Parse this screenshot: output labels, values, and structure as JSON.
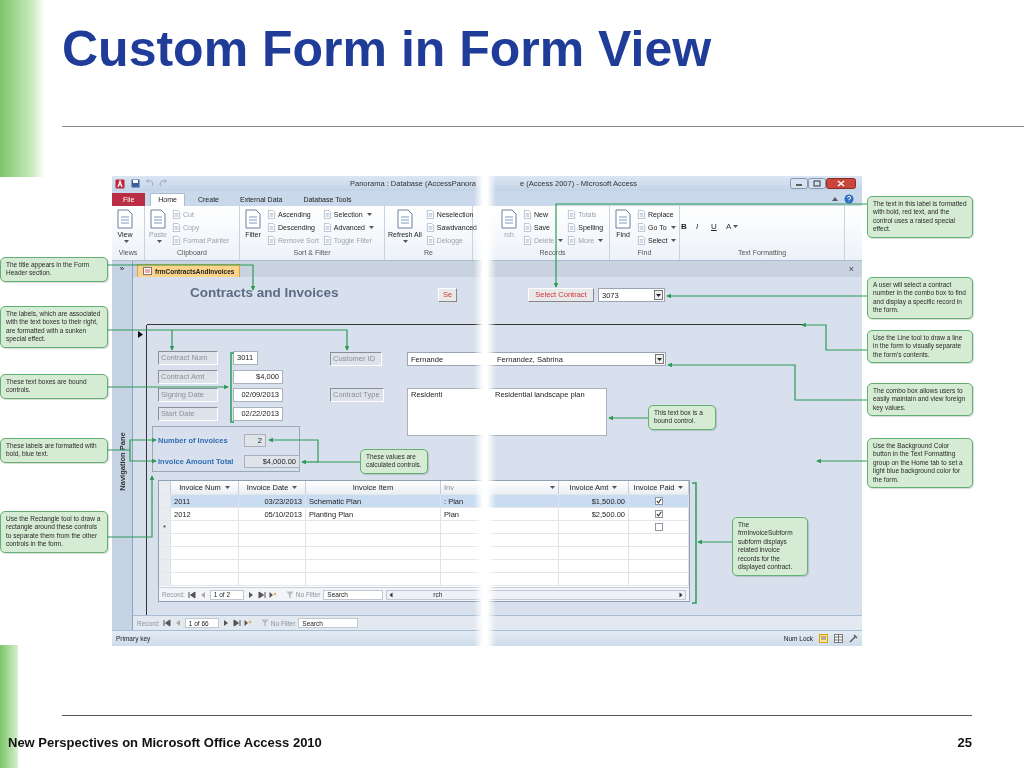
{
  "slide": {
    "title": "Custom Form in Form View",
    "footer": "New Perspectives on Microsoft Office Access 2010",
    "page_number": "25"
  },
  "window": {
    "title_parts": [
      "Panorama : Database (AccessPanora",
      "e (Access 2007) - Microsoft Access"
    ],
    "tabs": [
      {
        "label": "File",
        "kind": "file",
        "selected": false
      },
      {
        "label": "Home",
        "kind": "tab",
        "selected": true
      },
      {
        "label": "Create",
        "kind": "tab",
        "selected": false
      },
      {
        "label": "External Data",
        "kind": "tab",
        "selected": false
      },
      {
        "label": "Database Tools",
        "kind": "tab",
        "selected": false
      }
    ]
  },
  "ribbon": {
    "groups": [
      {
        "label": "Views",
        "commands": [
          {
            "label": "View",
            "kind": "large",
            "disabled": false,
            "dropdown": true
          }
        ]
      },
      {
        "label": "Clipboard",
        "commands": [
          {
            "label": "Paste",
            "kind": "large",
            "disabled": true,
            "dropdown": true
          },
          {
            "label": "Cut",
            "kind": "small",
            "disabled": true,
            "dropdown": false
          },
          {
            "label": "Copy",
            "kind": "small",
            "disabled": true,
            "dropdown": false
          },
          {
            "label": "Format Painter",
            "kind": "small",
            "disabled": true,
            "dropdown": false
          }
        ]
      },
      {
        "label": "Sort & Filter",
        "commands": [
          {
            "label": "Filter",
            "kind": "large",
            "disabled": false,
            "dropdown": false
          },
          {
            "label": "Ascending",
            "kind": "small",
            "disabled": false,
            "dropdown": false
          },
          {
            "label": "Descending",
            "kind": "small",
            "disabled": false,
            "dropdown": false
          },
          {
            "label": "Remove Sort",
            "kind": "small",
            "disabled": true,
            "dropdown": false
          },
          {
            "label": "Selection",
            "kind": "small",
            "disabled": false,
            "dropdown": true
          },
          {
            "label": "Advanced",
            "kind": "small",
            "disabled": false,
            "dropdown": true
          },
          {
            "label": "Toggle Filter",
            "kind": "small",
            "disabled": true,
            "dropdown": false
          }
        ]
      },
      {
        "label": "Re",
        "commands": [
          {
            "label": "Refresh All",
            "kind": "large",
            "disabled": false,
            "dropdown": true
          },
          {
            "label": "Neselection",
            "kind": "small",
            "disabled": false,
            "dropdown": false
          },
          {
            "label": "Sawdvanced",
            "kind": "small",
            "disabled": false,
            "dropdown": false
          },
          {
            "label": "Delogge",
            "kind": "small",
            "disabled": true,
            "dropdown": false
          }
        ]
      },
      {
        "label": "Records",
        "commands": [
          {
            "label": "rch",
            "kind": "large",
            "disabled": true,
            "dropdown": false
          },
          {
            "label": "New",
            "kind": "small",
            "disabled": false,
            "dropdown": false
          },
          {
            "label": "Save",
            "kind": "small",
            "disabled": false,
            "dropdown": false
          },
          {
            "label": "Delete",
            "kind": "small",
            "disabled": true,
            "dropdown": true
          },
          {
            "label": "Totals",
            "kind": "small",
            "disabled": true,
            "dropdown": false
          },
          {
            "label": "Spelling",
            "kind": "small",
            "disabled": false,
            "dropdown": false
          },
          {
            "label": "More",
            "kind": "small",
            "disabled": true,
            "dropdown": true
          }
        ]
      },
      {
        "label": "Find",
        "commands": [
          {
            "label": "Find",
            "kind": "large",
            "disabled": false,
            "dropdown": false
          },
          {
            "label": "Replace",
            "kind": "small",
            "disabled": false,
            "dropdown": false
          },
          {
            "label": "Go To",
            "kind": "small",
            "disabled": false,
            "dropdown": true
          },
          {
            "label": "Select",
            "kind": "small",
            "disabled": false,
            "dropdown": true
          }
        ]
      },
      {
        "label": "Text Formatting",
        "commands": [
          {
            "label": "B",
            "kind": "format",
            "disabled": false,
            "dropdown": false
          },
          {
            "label": "I",
            "kind": "format",
            "disabled": false,
            "dropdown": false
          },
          {
            "label": "U",
            "kind": "format",
            "disabled": false,
            "dropdown": false
          },
          {
            "label": "A",
            "kind": "format",
            "disabled": false,
            "dropdown": true
          }
        ]
      }
    ]
  },
  "navigation_pane": {
    "toggle": "»",
    "label": "Navigation Pane"
  },
  "document_tab": {
    "label": "frmContractsAndInvoices",
    "close": "×"
  },
  "form": {
    "title": "Contracts and Invoices",
    "select_button_fragment": "Se",
    "select_button": "Select Contract",
    "contract_combo": "3073",
    "fields": [
      {
        "label": "Contract Num",
        "value": "3011"
      },
      {
        "label": "Contract Amt",
        "value": "$4,000"
      },
      {
        "label": "Signing Date",
        "value": "02/09/2013"
      },
      {
        "label": "Start Date",
        "value": "02/22/2013"
      }
    ],
    "customer_label": "Customer ID",
    "customer_value_parts": [
      "Fernande",
      "Fernandez, Sabrina"
    ],
    "type_label": "Contract Type",
    "type_value_parts": [
      "Residenti",
      "Residential landscape plan"
    ],
    "totals": [
      {
        "label": "Number of Invoices",
        "value": "2"
      },
      {
        "label": "Invoice Amount Total",
        "value": "$4,000.00"
      }
    ]
  },
  "subform": {
    "columns": [
      {
        "label": "Invoice Num"
      },
      {
        "label": "Invoice Date"
      },
      {
        "label": "Invoice Item"
      },
      {
        "label": "Inv"
      },
      {
        "label": "Invoice Amt"
      },
      {
        "label": "Invoice Paid"
      }
    ],
    "rows": [
      {
        "cells": [
          "2011",
          "03/23/2013",
          "Schematic Plan",
          ": Plan",
          "$1,500.00"
        ],
        "paid": true,
        "selected": true
      },
      {
        "cells": [
          "2012",
          "05/10/2013",
          "Planting Plan",
          "Plan",
          "$2,500.00"
        ],
        "paid": true,
        "selected": false
      }
    ],
    "new_row": {
      "marker": "*",
      "paid": false
    },
    "record_nav": {
      "label": "Record:",
      "position": "1 of 2",
      "filter": "No Filter",
      "search": "Search",
      "search_tail": "rch"
    }
  },
  "record_nav": {
    "label": "Record:",
    "position": "1 of 66",
    "filter": "No Filter",
    "search": "Search"
  },
  "status_bar": {
    "left": "Primary key",
    "right": "Num Lock"
  },
  "callouts": [
    {
      "text": "The title appears in the Form Header section."
    },
    {
      "text": "The labels, which are associated with the text boxes to their right, are formatted with a sunken special effect."
    },
    {
      "text": "These text boxes are bound controls."
    },
    {
      "text": "These labels are formatted with bold, blue text."
    },
    {
      "text": "Use the Rectangle tool to draw a rectangle around these controls to separate them from the other controls in the form."
    },
    {
      "text": "The text in this label is formatted with bold, red text, and the control uses a raised special effect."
    },
    {
      "text": "A user will select a contract number in the combo box to find and display a specific record in the form."
    },
    {
      "text": "Use the Line tool to draw a line in the form to visually separate the form’s contents."
    },
    {
      "text": "The combo box allows users to easily maintain and view foreign key values."
    },
    {
      "text": "Use the Background Color button in the Text Formatting group on the Home tab to set a light blue background color for the form."
    },
    {
      "text": "This text box is a bound control."
    },
    {
      "text": "These values are calculated controls."
    },
    {
      "text": "The frmInvoiceSubform subform displays related invoice records for the displayed contract."
    }
  ]
}
